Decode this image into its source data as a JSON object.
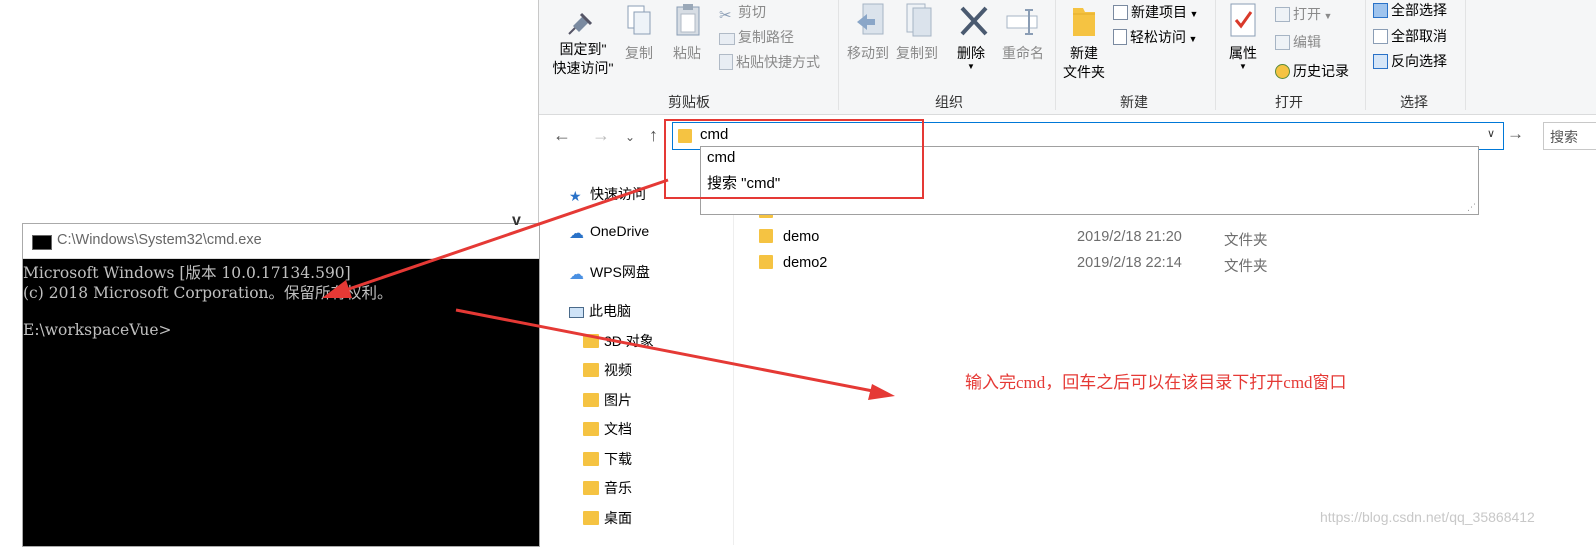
{
  "ribbon": {
    "pin_label_line1": "固定到\"",
    "pin_label_line2": "快速访问\"",
    "copy_label": "复制",
    "paste_label": "粘贴",
    "cut_label": "剪切",
    "copy_path_label": "复制路径",
    "paste_shortcut_label": "粘贴快捷方式",
    "clipboard_group": "剪贴板",
    "move_to_label": "移动到",
    "copy_to_label": "复制到",
    "delete_label": "删除",
    "rename_label": "重命名",
    "organize_group": "组织",
    "new_folder_line1": "新建",
    "new_folder_line2": "文件夹",
    "new_item_label": "新建项目",
    "easy_access_label": "轻松访问",
    "new_group": "新建",
    "properties_label": "属性",
    "open_label": "打开",
    "edit_label": "编辑",
    "history_label": "历史记录",
    "open_group": "打开",
    "select_all_label": "全部选择",
    "select_none_label": "全部取消",
    "invert_selection_label": "反向选择",
    "select_group": "选择"
  },
  "address": {
    "value": "cmd",
    "search_placeholder": "搜索"
  },
  "autocomplete": {
    "item1": "cmd",
    "item2": "搜索 \"cmd\""
  },
  "nav": {
    "quick_access": "快速访问",
    "onedrive": "OneDrive",
    "wps": "WPS网盘",
    "this_pc": "此电脑",
    "objects3d": "3D 对象",
    "videos": "视频",
    "pictures": "图片",
    "documents": "文档",
    "downloads": "下载",
    "music": "音乐",
    "desktop": "桌面"
  },
  "files": [
    {
      "name": "demo",
      "date": "2019/2/18 21:20",
      "type": "文件夹"
    },
    {
      "name": "demo2",
      "date": "2019/2/18 22:14",
      "type": "文件夹"
    }
  ],
  "cmd": {
    "title": "C:\\Windows\\System32\\cmd.exe",
    "line1": "Microsoft Windows [版本 10.0.17134.590]",
    "line2": "(c) 2018 Microsoft Corporation。保留所有权利。",
    "line3": "E:\\workspaceVue>"
  },
  "annotation": "输入完cmd，回车之后可以在该目录下打开cmd窗口",
  "watermark": "https://blog.csdn.net/qq_35868412",
  "colors": {
    "annotation_red": "#e53935",
    "accent_blue": "#0078d7",
    "folder_yellow": "#f5c342"
  }
}
